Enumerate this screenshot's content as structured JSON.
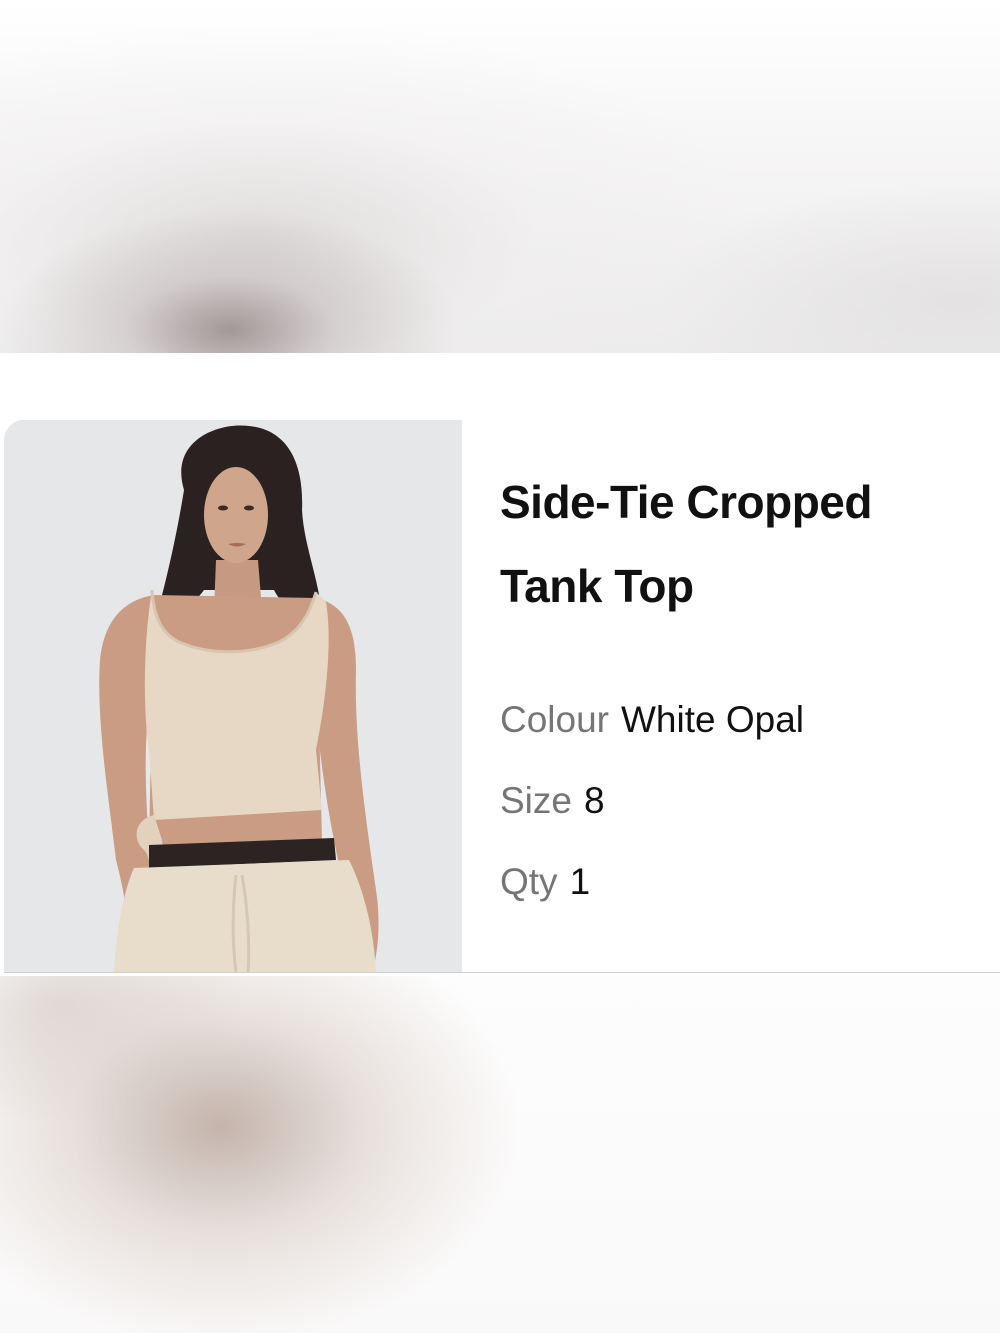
{
  "product": {
    "title_line1": "Side-Tie Cropped",
    "title_line2": "Tank Top",
    "colour_label": "Colour",
    "colour_value": "White Opal",
    "size_label": "Size",
    "size_value": "8",
    "qty_label": "Qty",
    "qty_value": "1"
  }
}
